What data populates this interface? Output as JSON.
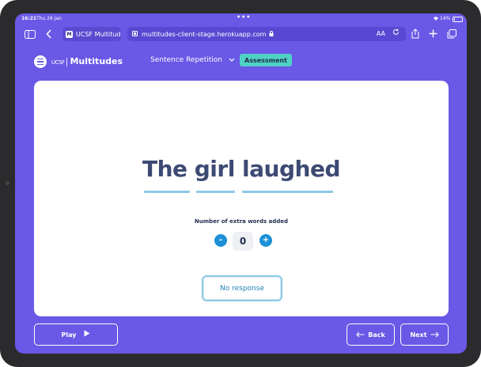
{
  "status": {
    "time": "16:21",
    "date": "Thu 26 Jan",
    "dots": "•••",
    "battery": "14%",
    "battery_level": 0.14
  },
  "browser": {
    "tab_title": "UCSF Multitude",
    "favicon": "M",
    "url": "multitudes-client-stage.herokuapp.com",
    "text_size_label": "AA",
    "icons": [
      "sidebar-icon",
      "back-chevron-icon",
      "lock-icon",
      "reload-icon",
      "share-icon",
      "plus-icon",
      "tabs-icon"
    ]
  },
  "header": {
    "brand_prefix": "UCSF",
    "brand_name": "Multitudes",
    "task_name": "Sentence Repetition",
    "mode_badge": "Assessment"
  },
  "card": {
    "sentence": "The girl laughed",
    "counter_label": "Number of extra words added",
    "minus_label": "-",
    "plus_label": "+",
    "count_value": "0",
    "no_response_label": "No response"
  },
  "footer": {
    "play_label": "Play",
    "back_label": "Back",
    "next_label": "Next"
  },
  "colors": {
    "background": "#6a58e6",
    "card": "#ffffff",
    "accent_blue": "#1e90d6",
    "badge_teal": "#4fd1c5",
    "underline": "#8cc8e6",
    "sentence_text": "#3c4a73"
  }
}
